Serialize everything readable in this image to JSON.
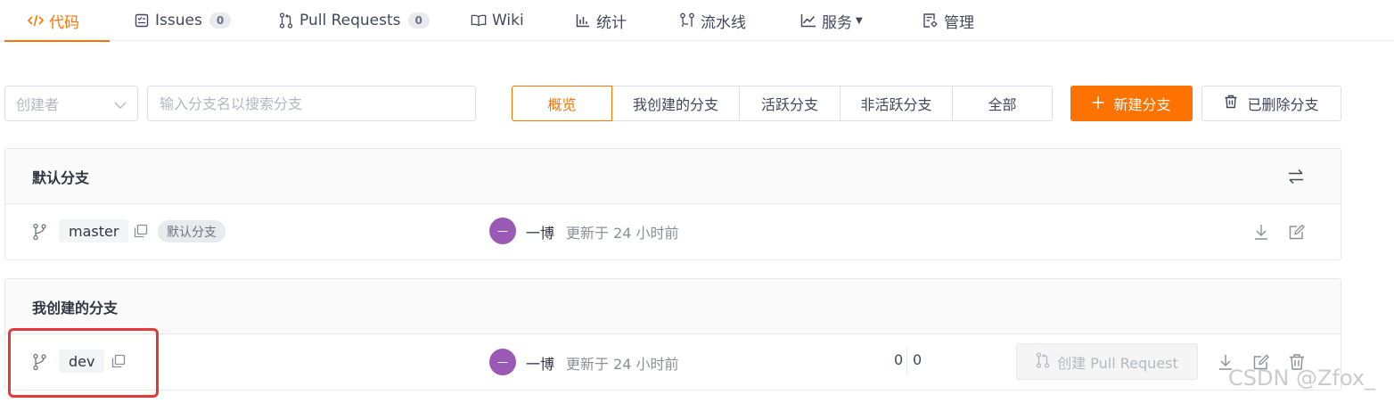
{
  "nav": {
    "tabs": [
      {
        "label": "代码",
        "icon": "code-icon",
        "active": true
      },
      {
        "label": "Issues",
        "count": "0",
        "icon": "issues-icon"
      },
      {
        "label": "Pull Requests",
        "count": "0",
        "icon": "pull-request-icon"
      },
      {
        "label": "Wiki",
        "icon": "book-icon"
      },
      {
        "label": "统计",
        "icon": "bar-chart-icon"
      },
      {
        "label": "流水线",
        "icon": "pipeline-icon"
      },
      {
        "label": "服务",
        "icon": "line-chart-icon"
      },
      {
        "label": "管理",
        "icon": "settings-doc-icon"
      }
    ]
  },
  "filters": {
    "creator_placeholder": "创建者",
    "search_placeholder": "输入分支名以搜索分支",
    "segments": [
      "概览",
      "我创建的分支",
      "活跃分支",
      "非活跃分支",
      "全部"
    ],
    "new_branch": "新建分支",
    "deleted_branches": "已删除分支"
  },
  "default_section": {
    "title": "默认分支",
    "branch": {
      "name": "master",
      "tag": "默认分支",
      "avatar_text": "一",
      "author": "一博",
      "updated": "更新于 24 小时前"
    }
  },
  "my_section": {
    "title": "我创建的分支",
    "branch": {
      "name": "dev",
      "avatar_text": "一",
      "author": "一博",
      "updated": "更新于 24 小时前",
      "behind": "0",
      "ahead": "0",
      "pr_button": "创建 Pull Request"
    }
  },
  "watermark": "CSDN @Zfox_",
  "colors": {
    "accent": "#fe7300",
    "avatar": "#9b59b6",
    "highlight": "#e5383b"
  }
}
